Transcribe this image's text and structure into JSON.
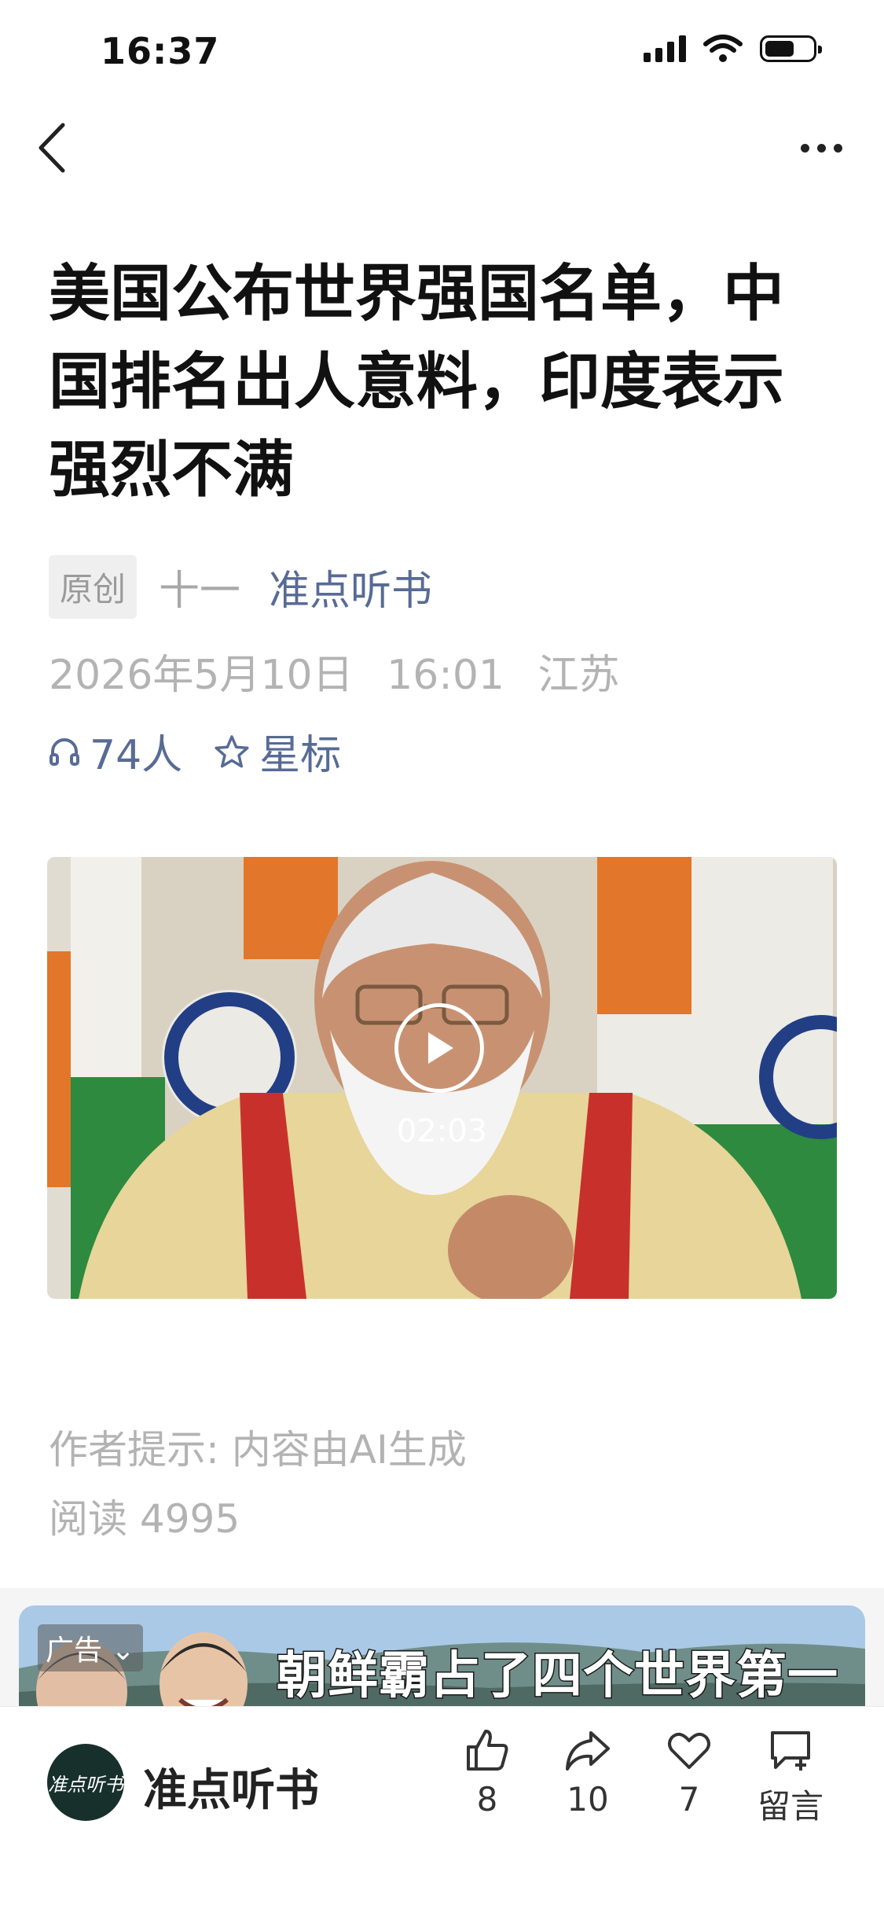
{
  "status_bar": {
    "time": "16:37"
  },
  "article": {
    "title": "美国公布世界强国名单，中国排名出人意料，印度表示强烈不满",
    "badge": "原创",
    "author": "十一",
    "account": "准点听书",
    "date": "2026年5月10日",
    "time": "16:01",
    "location": "江苏",
    "listeners": "74人",
    "star_label": "星标",
    "video_duration": "02:03",
    "ai_notice": "作者提示: 内容由AI生成",
    "reads": "阅读 4995"
  },
  "ad": {
    "label": "广告",
    "headline": "朝鲜霸占了四个世界第一"
  },
  "bottom_bar": {
    "account_name": "准点听书",
    "avatar_text": "准点听书",
    "like_count": "8",
    "share_count": "10",
    "favorite_count": "7",
    "comment_label": "留言"
  },
  "colors": {
    "link": "#576b95",
    "muted": "#b3b3b3"
  },
  "icons": [
    "chevron-left-icon",
    "more-dots-icon",
    "headphones-icon",
    "star-icon",
    "play-icon",
    "thumbs-up-icon",
    "share-icon",
    "heart-icon",
    "comment-icon"
  ]
}
